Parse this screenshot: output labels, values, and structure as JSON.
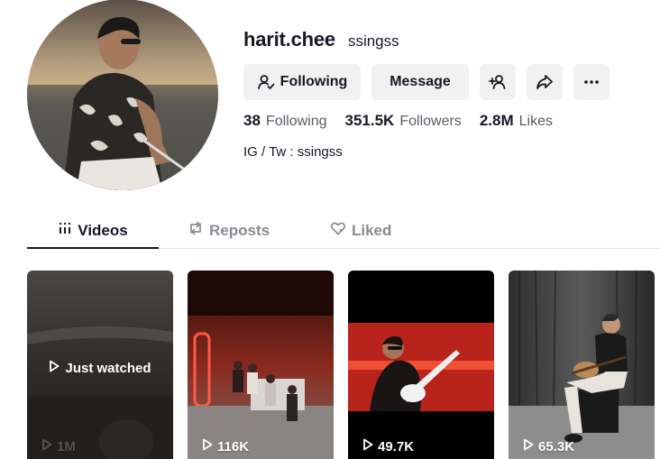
{
  "profile": {
    "username": "harit.chee",
    "nickname": "ssingss",
    "bio": "IG / Tw : ssingss"
  },
  "actions": {
    "following_label": "Following",
    "message_label": "Message",
    "add_friend_icon": "add-user-icon",
    "share_icon": "share-icon",
    "more_icon": "more-icon"
  },
  "stats": {
    "following_count": "38",
    "following_label": "Following",
    "followers_count": "351.5K",
    "followers_label": "Followers",
    "likes_count": "2.8M",
    "likes_label": "Likes"
  },
  "tabs": [
    {
      "label": "Videos",
      "icon": "grid-icon",
      "active": true
    },
    {
      "label": "Reposts",
      "icon": "repost-icon",
      "active": false
    },
    {
      "label": "Liked",
      "icon": "heart-icon",
      "active": false
    }
  ],
  "videos": [
    {
      "views": "1M",
      "overlay": "Just watched"
    },
    {
      "views": "116K"
    },
    {
      "views": "49.7K"
    },
    {
      "views": "65.3K"
    }
  ]
}
